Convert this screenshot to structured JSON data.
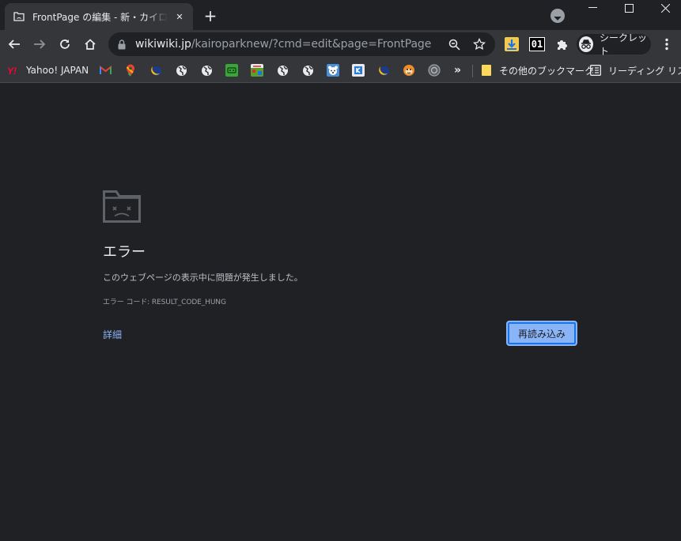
{
  "tab": {
    "title": "FrontPage の編集 - 新・カイロパーク攻略",
    "close_glyph": "✕"
  },
  "new_tab_glyph": "+",
  "window_controls": {
    "minimize": "—",
    "maximize": "☐",
    "close": "✕"
  },
  "omnibox": {
    "host": "wikiwiki.jp",
    "path": "/kairoparknew/?cmd=edit&page=FrontPage"
  },
  "extensions": {
    "counter_label": "01"
  },
  "profile": {
    "label": "シークレット"
  },
  "bookmarks": {
    "items": [
      {
        "label": "Yahoo! JAPAN",
        "icon": "yahoo-icon",
        "color": "#ff0033"
      },
      {
        "label": "",
        "icon": "gmail-icon",
        "color": "#ea4335"
      },
      {
        "label": "",
        "icon": "maps-icon",
        "color": "#34a853"
      },
      {
        "label": "",
        "icon": "crescent-icon",
        "color": "#fbbc04"
      },
      {
        "label": "",
        "icon": "globe-icon",
        "color": "#e8eaed"
      },
      {
        "label": "",
        "icon": "globe-icon",
        "color": "#e8eaed"
      },
      {
        "label": "",
        "icon": "green-app-icon",
        "color": "#3aa53a"
      },
      {
        "label": "",
        "icon": "game-icon",
        "color": "#5aa02c"
      },
      {
        "label": "",
        "icon": "globe-icon",
        "color": "#e8eaed"
      },
      {
        "label": "",
        "icon": "globe-icon",
        "color": "#e8eaed"
      },
      {
        "label": "",
        "icon": "bear-icon",
        "color": "#4a90d9"
      },
      {
        "label": "",
        "icon": "kairo-icon",
        "color": "#2b7bd6"
      },
      {
        "label": "",
        "icon": "crescent-icon",
        "color": "#fbbc04"
      },
      {
        "label": "",
        "icon": "monkey-icon",
        "color": "#f08c28"
      },
      {
        "label": "",
        "icon": "gray-app-icon",
        "color": "#9aa0a6"
      }
    ],
    "overflow_glyph": "»",
    "other_folder": "その他のブックマーク",
    "reading_list": "リーディング リスト"
  },
  "error_page": {
    "title": "エラー",
    "message": "このウェブページの表示中に問題が発生しました。",
    "code": "エラー コード: RESULT_CODE_HUNG",
    "details_link": "詳細",
    "reload_button": "再読み込み"
  },
  "colors": {
    "background": "#202124",
    "toolbar": "#35363a",
    "link": "#8ab4f8",
    "button": "#8ab4f8"
  }
}
